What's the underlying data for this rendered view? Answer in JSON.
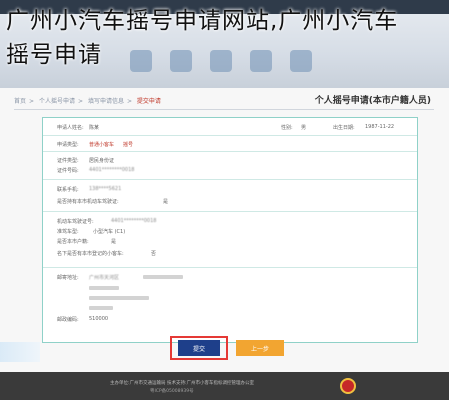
{
  "overlay": {
    "title_line1": "广州小汽车摇号申请网站,广州小汽车",
    "title_line2": "摇号申请"
  },
  "breadcrumb": {
    "items": [
      "首页",
      "个人摇号申请",
      "填写申请信息"
    ],
    "current": "提交申请"
  },
  "form": {
    "title": "个人摇号申请(本市户籍人员)",
    "rows": [
      {
        "label": "申请人姓名:",
        "value": "陈某",
        "extra_label": "性别:",
        "extra_value": "男",
        "date_label": "出生日期:",
        "date_value": "1987-11-22"
      },
      {
        "label": "申请类型:",
        "value": "普通小客车",
        "highlight": "摇号"
      },
      {
        "label": "证件类型:",
        "value": "居民身份证"
      },
      {
        "label": "证件号码:",
        "value": "4401********0018"
      },
      {
        "label": "联系手机:",
        "value": "138****5621"
      },
      {
        "label": "是否持有本市机动车驾驶证:",
        "value": "是"
      },
      {
        "label": "机动车驾驶证号:",
        "value": "4401********0018"
      },
      {
        "label": "准驾车型:",
        "value": "小型汽车 (C1)"
      },
      {
        "label": "是否本市户籍:",
        "value": "是"
      },
      {
        "label": "名下是否有本市登记的小客车:",
        "value": "否"
      },
      {
        "label": "邮寄地址:",
        "value": "广州市天河区"
      },
      {
        "label": "邮政编码:",
        "value": "510000"
      }
    ]
  },
  "buttons": {
    "submit": "提交",
    "back": "上一步"
  },
  "footer": {
    "line1": "主办单位:广州市交通运输局 技术支持:广州市小客车指标调控管理办公室",
    "line2": "粤ICP备05008939号"
  },
  "colors": {
    "primary": "#1e3f8a",
    "secondary": "#f2a531",
    "highlight_border": "#e53935",
    "card_border": "#8fd1c8",
    "footer_bg": "#3a3a3a"
  }
}
